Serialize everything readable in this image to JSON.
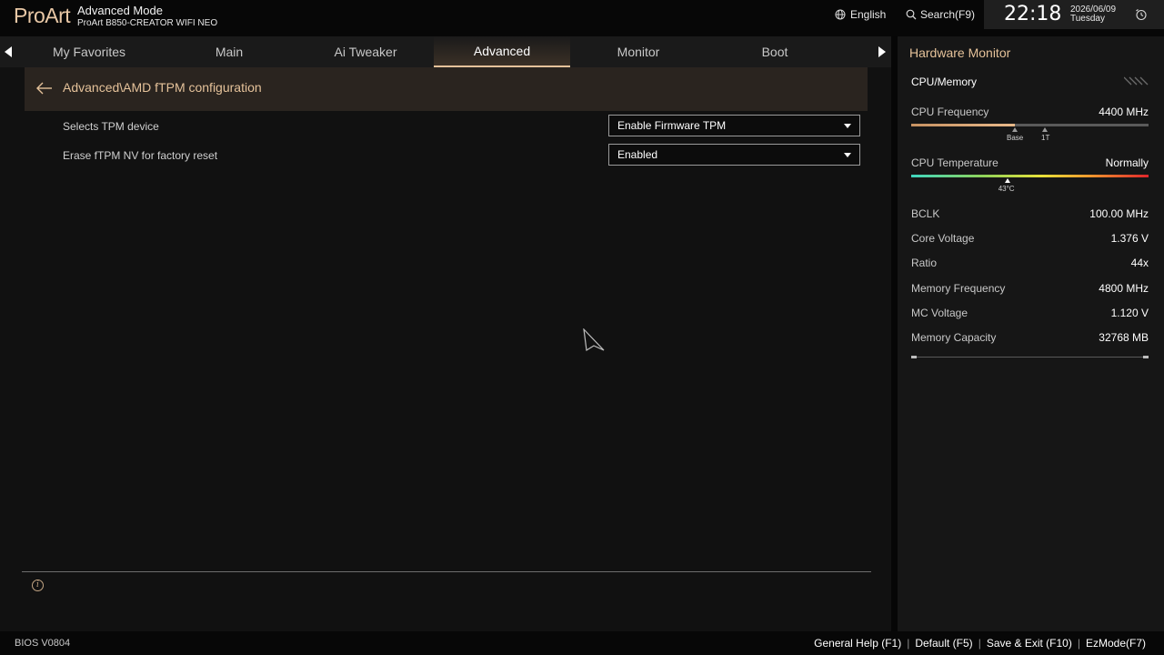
{
  "header": {
    "logo": "ProArt",
    "mode_title": "Advanced Mode",
    "board_name": "ProArt B850-CREATOR WIFI NEO",
    "language": "English",
    "search": "Search(F9)",
    "time": "22:18",
    "date": "2026/06/09",
    "weekday": "Tuesday"
  },
  "tabs": [
    {
      "label": "My Favorites"
    },
    {
      "label": "Main"
    },
    {
      "label": "Ai Tweaker"
    },
    {
      "label": "Advanced",
      "active": true
    },
    {
      "label": "Monitor"
    },
    {
      "label": "Boot"
    }
  ],
  "breadcrumb": "Advanced\\AMD fTPM configuration",
  "settings": [
    {
      "label": "Selects TPM device",
      "value": "Enable Firmware TPM"
    },
    {
      "label": "Erase fTPM NV for factory reset",
      "value": "Enabled"
    }
  ],
  "hardware_monitor": {
    "title": "Hardware Monitor",
    "section": "CPU/Memory",
    "cpu_frequency": {
      "label": "CPU Frequency",
      "value": "4400 MHz",
      "fill_fraction": 0.435,
      "marker_base": "Base",
      "marker_1t": "1T"
    },
    "cpu_temperature": {
      "label": "CPU Temperature",
      "value": "Normally",
      "marker": "43°C",
      "marker_fraction": 0.405
    },
    "rows": [
      {
        "label": "BCLK",
        "value": "100.00 MHz"
      },
      {
        "label": "Core Voltage",
        "value": "1.376 V"
      },
      {
        "label": "Ratio",
        "value": "44x"
      },
      {
        "label": "Memory Frequency",
        "value": "4800 MHz"
      },
      {
        "label": "MC Voltage",
        "value": "1.120 V"
      },
      {
        "label": "Memory Capacity",
        "value": "32768 MB"
      }
    ]
  },
  "footer": {
    "bios_version": "BIOS V0804",
    "shortcuts": [
      "General Help (F1)",
      "Default (F5)",
      "Save & Exit (F10)",
      "EzMode(F7)"
    ]
  },
  "colors": {
    "accent": "#e5c29a",
    "breadcrumb_bg": "#2a241f"
  }
}
